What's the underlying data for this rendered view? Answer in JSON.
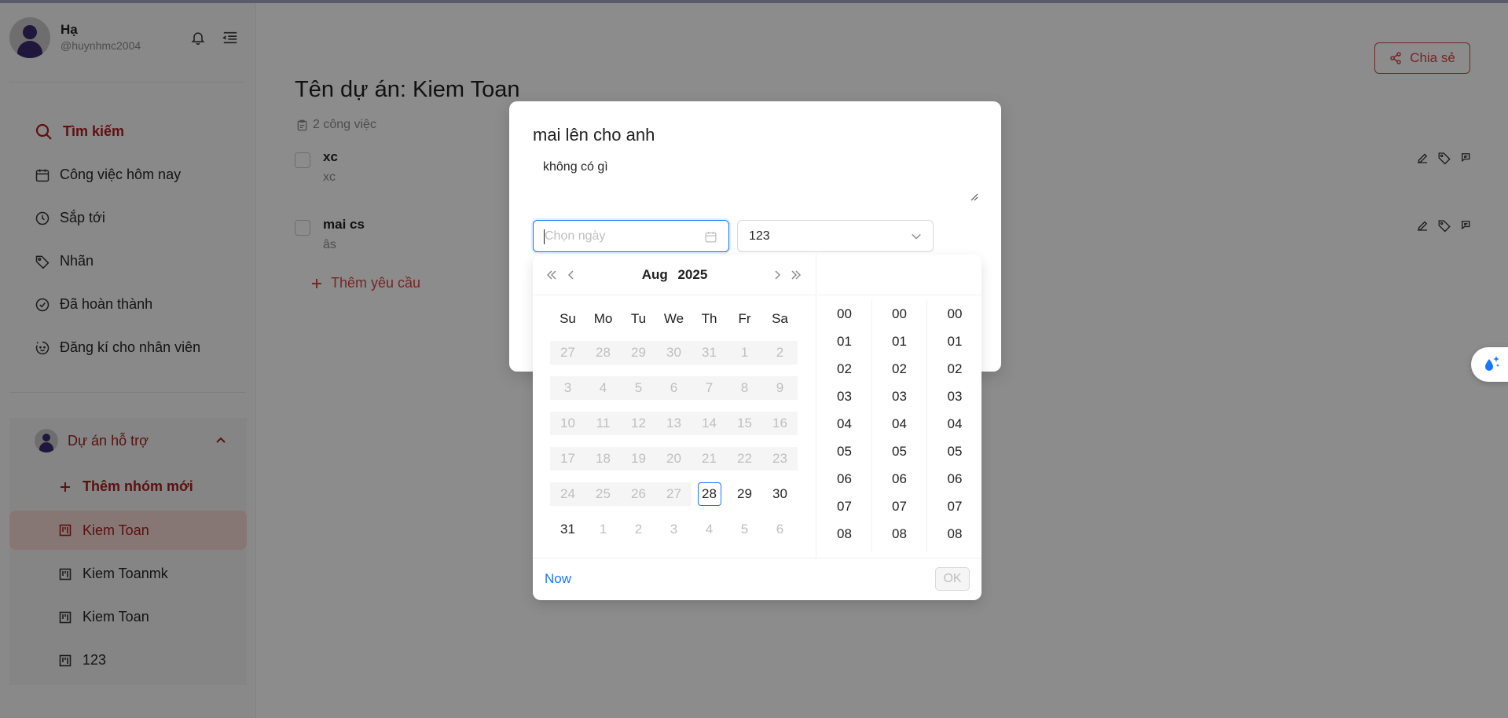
{
  "user": {
    "name": "Hạ",
    "handle": "@huynhmc2004"
  },
  "nav": {
    "search": "Tìm kiếm",
    "items": [
      {
        "label": "Công việc hôm nay",
        "icon": "calendar-icon"
      },
      {
        "label": "Sắp tới",
        "icon": "clock-icon"
      },
      {
        "label": "Nhãn",
        "icon": "tag-icon"
      },
      {
        "label": "Đã hoàn thành",
        "icon": "check-circle-icon"
      },
      {
        "label": "Đăng kí cho nhân viên",
        "icon": "smile-icon"
      }
    ]
  },
  "projects": {
    "header": "Dự án hỗ trợ",
    "add_group": "Thêm nhóm mới",
    "items": [
      {
        "label": "Kiem Toan",
        "active": true
      },
      {
        "label": "Kiem Toanmk",
        "active": false
      },
      {
        "label": "Kiem Toan",
        "active": false
      },
      {
        "label": "123",
        "active": false
      }
    ]
  },
  "main": {
    "share_label": "Chia sẻ",
    "title": "Tên dự án: Kiem Toan",
    "task_count": "2 công việc",
    "tasks": [
      {
        "title": "xc",
        "desc": "xc"
      },
      {
        "title": "mai cs",
        "desc": "âs"
      }
    ],
    "add_request": "Thêm yêu cầu"
  },
  "modal": {
    "title": "mai lên cho anh",
    "description": "không có gì",
    "date_placeholder": "Chọn ngày",
    "select_value": "123"
  },
  "picker": {
    "month": "Aug",
    "year": "2025",
    "weekdays": [
      "Su",
      "Mo",
      "Tu",
      "We",
      "Th",
      "Fr",
      "Sa"
    ],
    "weeks": [
      [
        "27",
        "28",
        "29",
        "30",
        "31",
        "1",
        "2"
      ],
      [
        "3",
        "4",
        "5",
        "6",
        "7",
        "8",
        "9"
      ],
      [
        "10",
        "11",
        "12",
        "13",
        "14",
        "15",
        "16"
      ],
      [
        "17",
        "18",
        "19",
        "20",
        "21",
        "22",
        "23"
      ],
      [
        "24",
        "25",
        "26",
        "27",
        "28",
        "29",
        "30"
      ],
      [
        "31",
        "1",
        "2",
        "3",
        "4",
        "5",
        "6"
      ]
    ],
    "today": "28",
    "hours": [
      "00",
      "01",
      "02",
      "03",
      "04",
      "05",
      "06",
      "07",
      "08"
    ],
    "minutes": [
      "00",
      "01",
      "02",
      "03",
      "04",
      "05",
      "06",
      "07",
      "08"
    ],
    "seconds": [
      "00",
      "01",
      "02",
      "03",
      "04",
      "05",
      "06",
      "07",
      "08"
    ],
    "now_label": "Now",
    "ok_label": "OK"
  },
  "colors": {
    "accent": "#1677ff",
    "brand_red": "#a3201e",
    "share_red": "#d64545"
  }
}
